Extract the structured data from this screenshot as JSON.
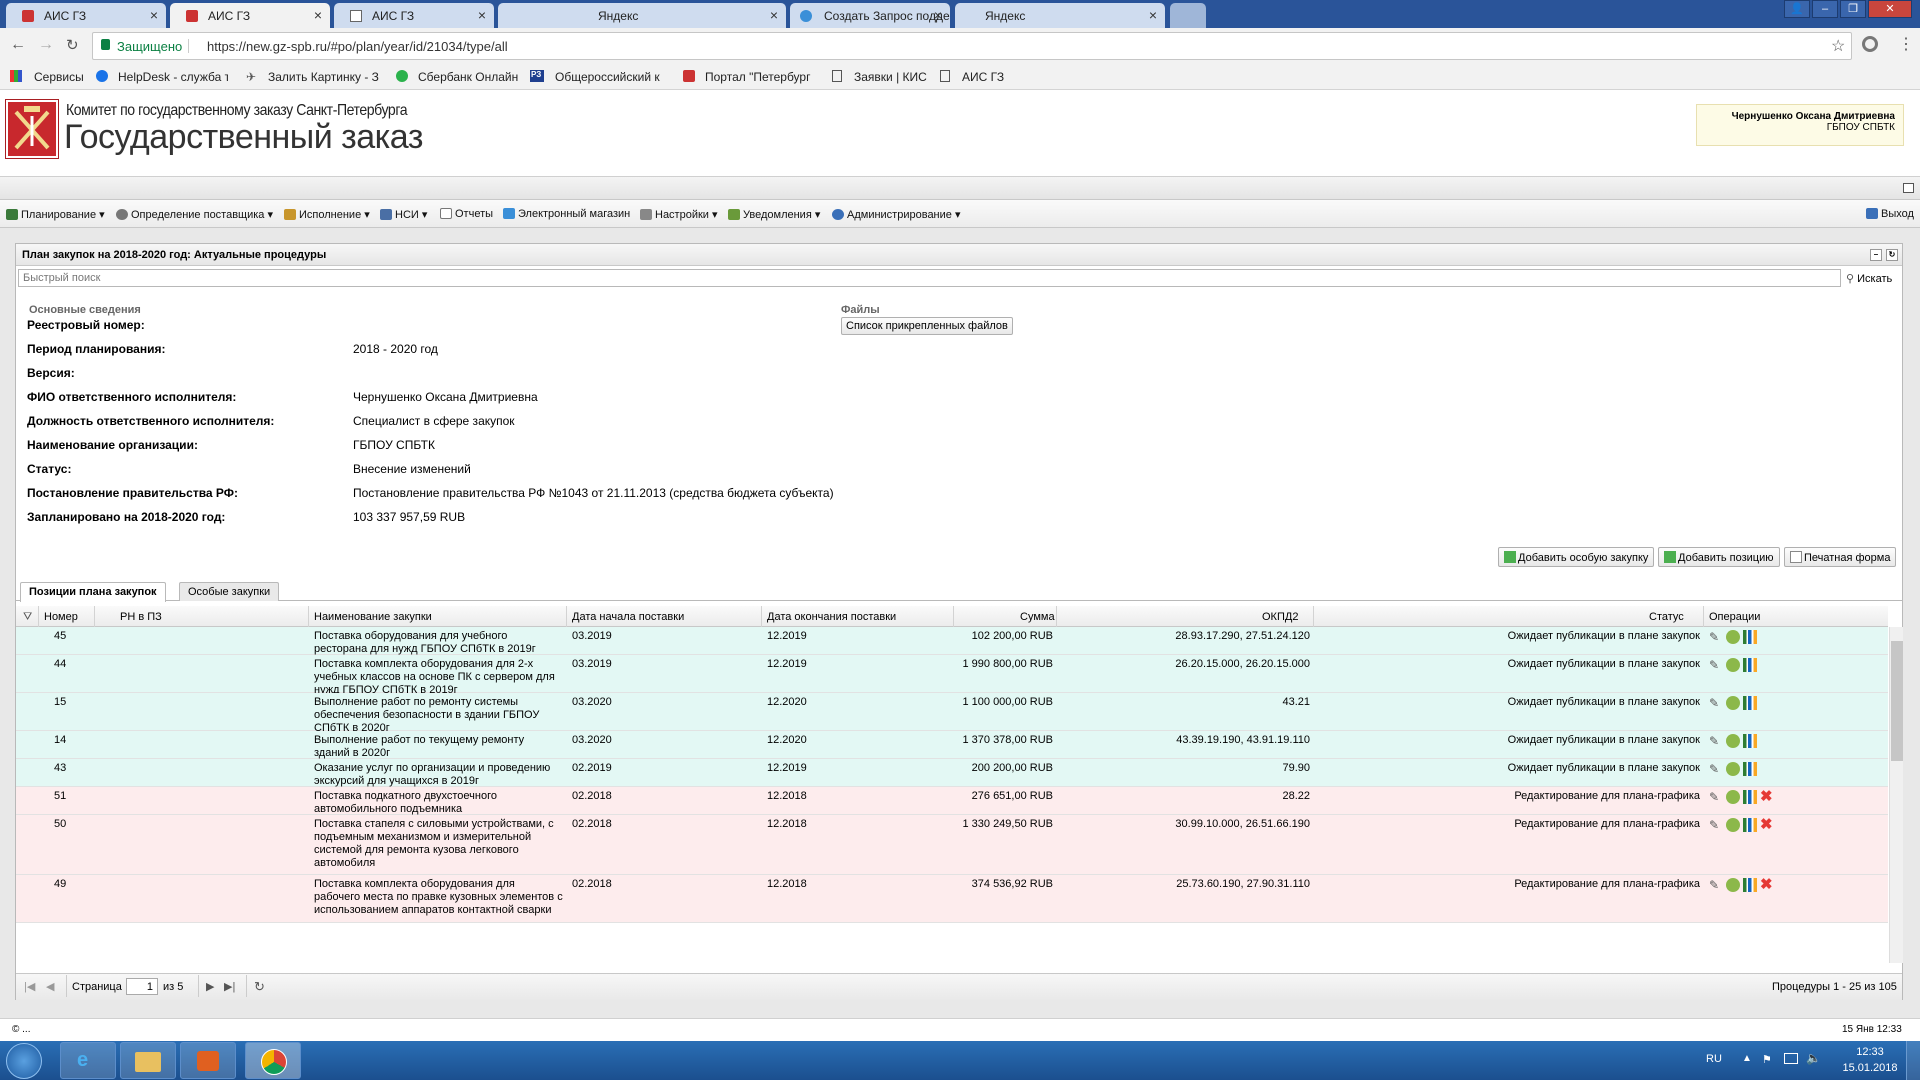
{
  "browser": {
    "tabs": [
      {
        "title": "АИС ГЗ",
        "active": false
      },
      {
        "title": "АИС ГЗ",
        "active": true
      },
      {
        "title": "АИС ГЗ",
        "active": false
      },
      {
        "title": "Яндекс",
        "active": false
      },
      {
        "title": "Создать Запрос поддер",
        "active": false
      },
      {
        "title": "Яндекс",
        "active": false
      }
    ],
    "secure_label": "Защищено",
    "url": "https://new.gz-spb.ru/#po/plan/year/id/21034/type/all",
    "bookmarks": [
      "Сервисы",
      "HelpDesk - служба т",
      "Залить Картинку - З",
      "Сбербанк Онлайн",
      "Общероссийский к",
      "Портал \"Петербург",
      "Заявки | КИС",
      "АИС ГЗ"
    ]
  },
  "header": {
    "org_line": "Комитет по государственному заказу Санкт-Петербурга",
    "app_title": "Государственный заказ",
    "user_name": "Чернушенко Оксана Дмитриевна",
    "user_org": "ГБПОУ СПБТК"
  },
  "menu": {
    "items": [
      "Планирование",
      "Определение поставщика",
      "Исполнение",
      "НСИ",
      "Отчеты",
      "Электронный магазин",
      "Настройки",
      "Уведомления",
      "Администрирование"
    ],
    "logout": "Выход"
  },
  "panel": {
    "title": "План закупок на 2018-2020 год: Актуальные процедуры",
    "search_placeholder": "Быстрый поиск",
    "search_button": "Искать",
    "section_main": "Основные сведения",
    "section_files": "Файлы",
    "files_button": "Список прикрепленных файлов",
    "fields": [
      {
        "label": "Реестровый номер:",
        "value": ""
      },
      {
        "label": "Период планирования:",
        "value": "2018 - 2020 год"
      },
      {
        "label": "Версия:",
        "value": ""
      },
      {
        "label": "ФИО ответственного исполнителя:",
        "value": "Чернушенко Оксана Дмитриевна"
      },
      {
        "label": "Должность ответственного исполнителя:",
        "value": "Специалист в сфере закупок"
      },
      {
        "label": "Наименование организации:",
        "value": "ГБПОУ СПБТК"
      },
      {
        "label": "Статус:",
        "value": "Внесение изменений"
      },
      {
        "label": "Постановление правительства РФ:",
        "value": "Постановление правительства РФ №1043 от 21.11.2013 (средства бюджета субъекта)"
      },
      {
        "label": "Запланировано на 2018-2020 год:",
        "value": "103 337 957,59 RUB"
      }
    ],
    "actions": [
      "Добавить особую закупку",
      "Добавить позицию",
      "Печатная форма"
    ]
  },
  "grid": {
    "tabs": [
      "Позиции плана закупок",
      "Особые закупки"
    ],
    "columns": [
      "Номер",
      "РН в ПЗ",
      "Наименование закупки",
      "Дата начала поставки",
      "Дата окончания поставки",
      "Сумма",
      "ОКПД2",
      "Статус",
      "Операции"
    ],
    "rows": [
      {
        "num": "45",
        "rn": "",
        "name": "Поставка оборудования для учебного ресторана для нужд ГБПОУ СПбТК в 2019г",
        "start": "03.2019",
        "end": "12.2019",
        "sum": "102 200,00 RUB",
        "okpd": "28.93.17.290, 27.51.24.120",
        "status": "Ожидает публикации в плане закупок",
        "tone": "g"
      },
      {
        "num": "44",
        "rn": "",
        "name": "Поставка комплекта оборудования для 2-х учебных классов на основе ПК с сервером для нужд ГБПОУ СПбТК в 2019г",
        "start": "03.2019",
        "end": "12.2019",
        "sum": "1 990 800,00 RUB",
        "okpd": "26.20.15.000, 26.20.15.000",
        "status": "Ожидает публикации в плане закупок",
        "tone": "g"
      },
      {
        "num": "15",
        "rn": "",
        "name": "Выполнение работ по ремонту системы обеспечения безопасности в здании ГБПОУ СПбТК в 2020г",
        "start": "03.2020",
        "end": "12.2020",
        "sum": "1 100 000,00 RUB",
        "okpd": "43.21",
        "status": "Ожидает публикации в плане закупок",
        "tone": "g"
      },
      {
        "num": "14",
        "rn": "",
        "name": "Выполнение работ по текущему ремонту зданий в 2020г",
        "start": "03.2020",
        "end": "12.2020",
        "sum": "1 370 378,00 RUB",
        "okpd": "43.39.19.190, 43.91.19.110",
        "status": "Ожидает публикации в плане закупок",
        "tone": "g"
      },
      {
        "num": "43",
        "rn": "",
        "name": "Оказание услуг по организации и проведению экскурсий для учащихся в 2019г",
        "start": "02.2019",
        "end": "12.2019",
        "sum": "200 200,00 RUB",
        "okpd": "79.90",
        "status": "Ожидает публикации в плане закупок",
        "tone": "g"
      },
      {
        "num": "51",
        "rn": "",
        "name": "Поставка подкатного двухстоечного автомобильного подъемника",
        "start": "02.2018",
        "end": "12.2018",
        "sum": "276 651,00 RUB",
        "okpd": "28.22",
        "status": "Редактирование для плана-графика",
        "tone": "r"
      },
      {
        "num": "50",
        "rn": "",
        "name": "Поставка стапеля с силовыми устройствами, с подъемным механизмом и измерительной системой для ремонта кузова легкового автомобиля",
        "start": "02.2018",
        "end": "12.2018",
        "sum": "1 330 249,50 RUB",
        "okpd": "30.99.10.000, 26.51.66.190",
        "status": "Редактирование для плана-графика",
        "tone": "r"
      },
      {
        "num": "49",
        "rn": "",
        "name": "Поставка комплекта оборудования для рабочего места по правке кузовных элементов с использованием аппаратов контактной сварки",
        "start": "02.2018",
        "end": "12.2018",
        "sum": "374 536,92 RUB",
        "okpd": "25.73.60.190, 27.90.31.110",
        "status": "Редактирование для плана-графика",
        "tone": "r"
      }
    ],
    "pager": {
      "page_label": "Страница",
      "page": "1",
      "of": "из 5",
      "summary": "Процедуры 1 - 25 из 105"
    }
  },
  "status_line": {
    "left": "© ...",
    "right": "15 Янв 12:33"
  },
  "taskbar": {
    "lang": "RU",
    "time": "12:33",
    "date": "15.01.2018"
  }
}
